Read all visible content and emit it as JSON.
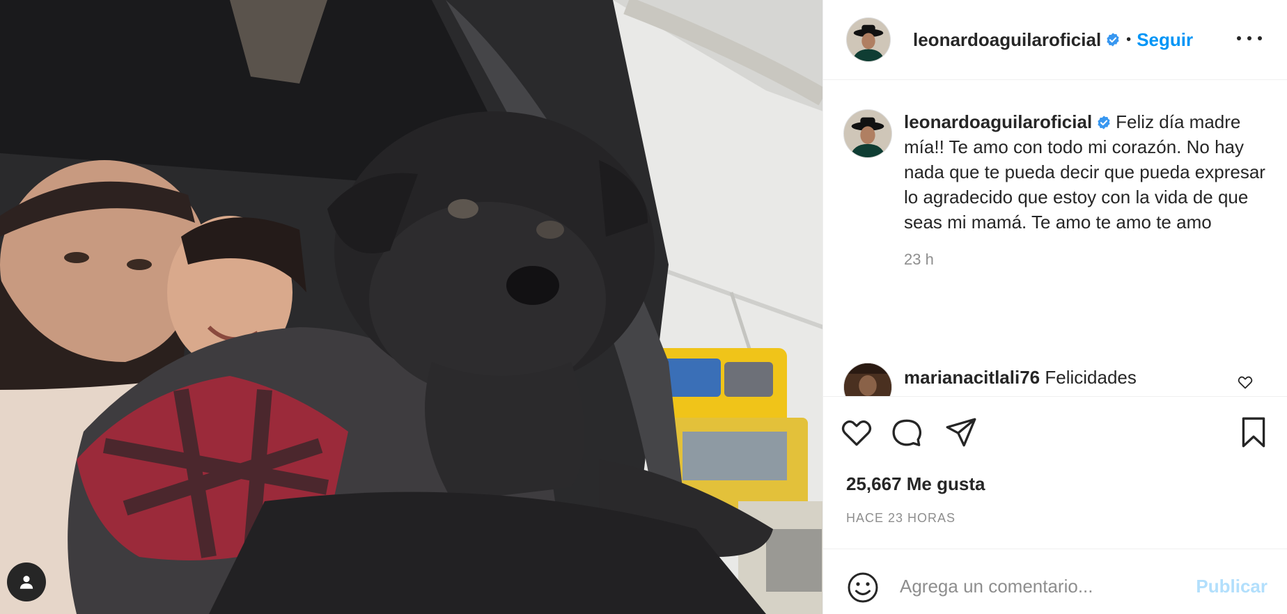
{
  "post": {
    "username": "leonardoaguilaroficial",
    "verified": true,
    "follow_label": "Seguir",
    "dot_separator": "•",
    "more_icon": "more-horizontal-icon"
  },
  "caption": {
    "username": "leonardoaguilaroficial",
    "text": "Feliz día madre mía!! Te amo con todo mi corazón. No hay nada que te pueda decir que pueda expresar lo agradecido que estoy con la vida de que seas mi mamá. Te amo te amo te amo",
    "time": "23 h"
  },
  "comments": [
    {
      "username": "marianacitlali76",
      "text": "Felicidades"
    }
  ],
  "actions": {
    "like_icon": "heart-icon",
    "comment_icon": "comment-icon",
    "share_icon": "send-icon",
    "save_icon": "bookmark-icon"
  },
  "likes_label": "25,667 Me gusta",
  "time_ago": "HACE 23 HORAS",
  "composer": {
    "placeholder": "Agrega un comentario...",
    "publish_label": "Publicar"
  },
  "colors": {
    "accent": "#0095f6",
    "accent_disabled": "#b2dffc",
    "text": "#262626",
    "secondary": "#8e8e8e",
    "verified": "#3897f0"
  }
}
